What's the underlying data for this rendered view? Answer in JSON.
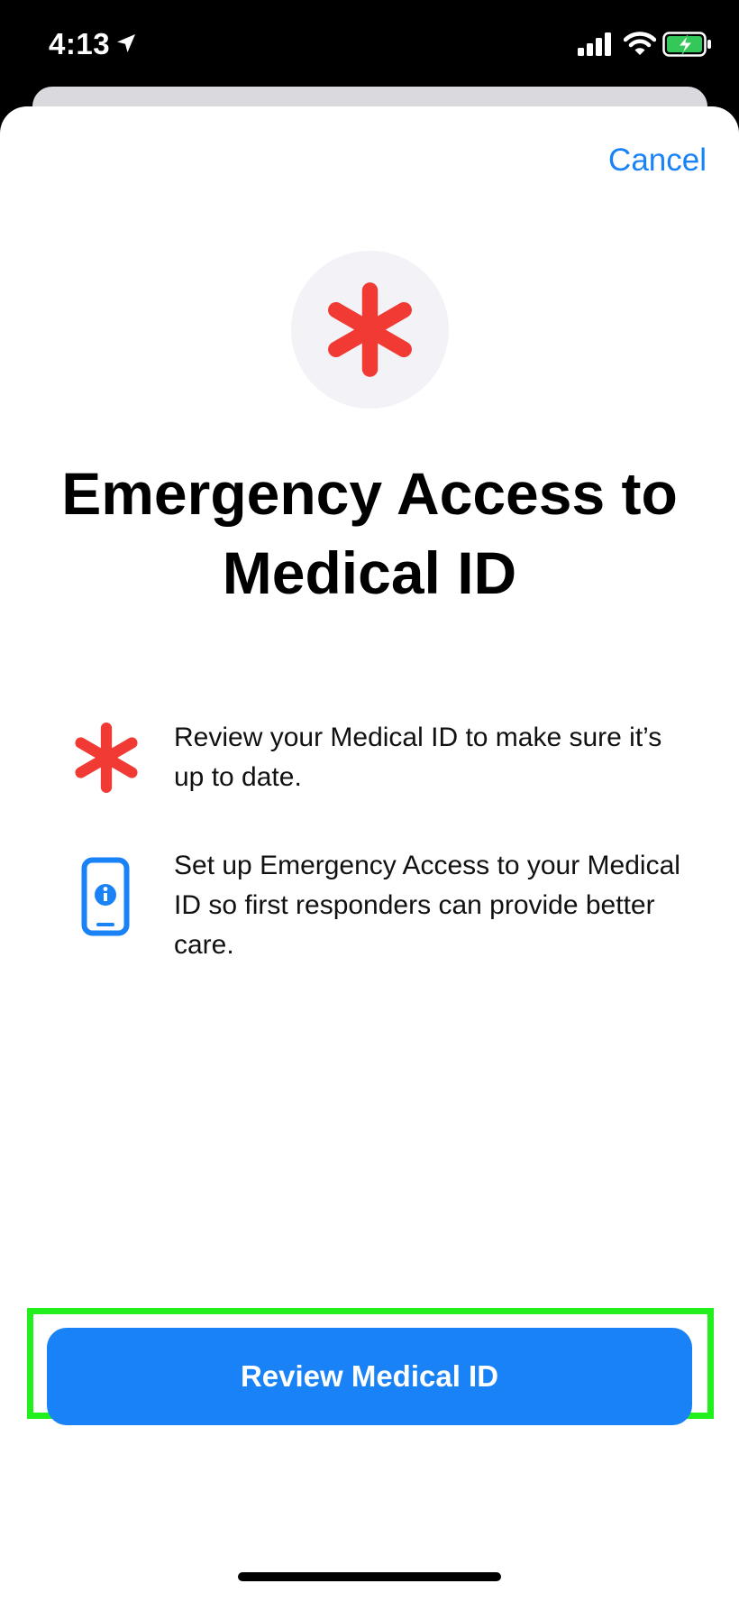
{
  "status_bar": {
    "time": "4:13"
  },
  "sheet": {
    "cancel_label": "Cancel",
    "title": "Emergency Access to Medical ID",
    "features": [
      {
        "icon": "medical-asterisk-icon",
        "text": "Review your Medical ID to make sure it’s up to date."
      },
      {
        "icon": "phone-info-icon",
        "text": "Set up Emergency Access to your Medical ID so first responders can provide better care."
      }
    ],
    "primary_button_label": "Review Medical ID"
  },
  "colors": {
    "accent_blue": "#1a82f7",
    "medical_red": "#f03a33",
    "highlight_green": "#22f01c",
    "battery_green": "#34c759"
  }
}
